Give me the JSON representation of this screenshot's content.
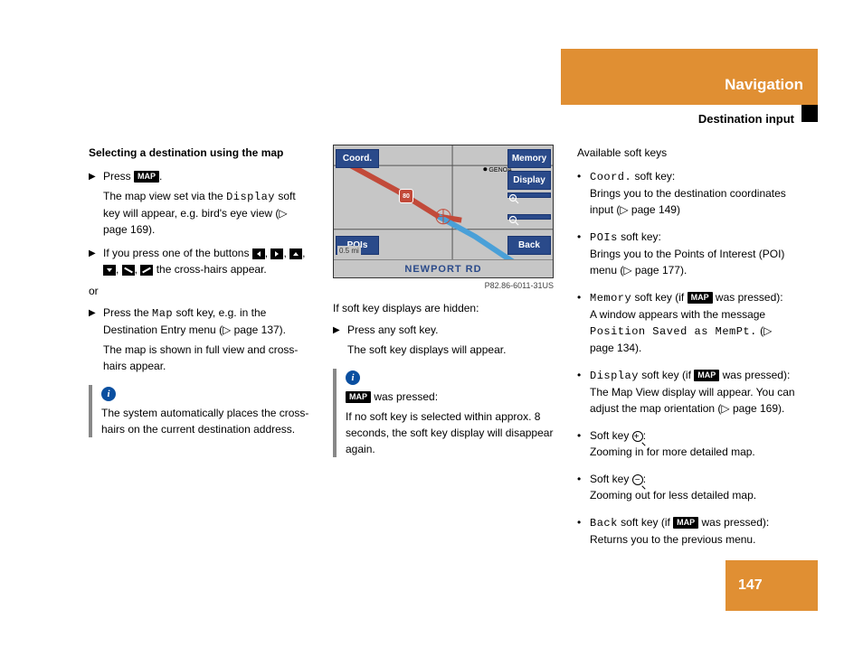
{
  "header": {
    "title": "Navigation",
    "subtitle": "Destination input"
  },
  "footer": {
    "page": "147"
  },
  "col1": {
    "heading": "Selecting a destination using the map",
    "step1_a": "Press ",
    "step1_b": ".",
    "step1_cont_a": "The map view set via the ",
    "step1_cont_b": "Display",
    "step1_cont_c": " soft key will appear, e.g. bird's eye view (▷ page 169).",
    "step2_a": "If you press one of the buttons ",
    "step2_b": " the cross-hairs appear.",
    "or": "or",
    "step3_a": "Press the ",
    "step3_b": "Map",
    "step3_c": " soft key, e.g. in the Destination Entry menu (▷ page 137).",
    "step3_cont": "The map is shown in full view and cross-hairs appear.",
    "info": "The system automatically places the cross-hairs on the current destination address."
  },
  "map": {
    "btn_coord": "Coord.",
    "btn_pois": "POIs",
    "btn_memory": "Memory",
    "btn_display": "Display",
    "btn_back": "Back",
    "road": "NEWPORT RD",
    "hwy": "80",
    "scale": "0.5 mi",
    "caption": "P82.86-6011-31US"
  },
  "col2": {
    "line1": "If soft key displays are hidden:",
    "step1": "Press any soft key.",
    "step1_cont": "The soft key displays will appear.",
    "info_a": " was pressed:",
    "info_b": "If no soft key is selected within approx. 8 seconds, the soft key display will disappear again."
  },
  "col3": {
    "heading": "Available soft keys",
    "b1_a": "Coord.",
    "b1_b": " soft key:",
    "b1_c": "Brings you to the destination coordinates input (▷ page 149)",
    "b2_a": "POIs",
    "b2_b": " soft key:",
    "b2_c": "Brings you to the Points of Interest (POI) menu (▷ page 177).",
    "b3_a": "Memory",
    "b3_b": " soft key (if ",
    "b3_c": " was pressed):",
    "b3_d": "A window appears with the message ",
    "b3_e": "Position Saved as MemPt.",
    "b3_f": " (▷ page 134).",
    "b4_a": "Display",
    "b4_b": " soft key (if ",
    "b4_c": " was pressed):",
    "b4_d": "The Map View display will appear. You can adjust the map orientation (▷ page 169).",
    "b5_a": "Soft key ",
    "b5_b": ":",
    "b5_c": "Zooming in for more detailed map.",
    "b6_a": "Soft key ",
    "b6_b": ":",
    "b6_c": "Zooming out for less detailed map.",
    "b7_a": "Back",
    "b7_b": " soft key (if ",
    "b7_c": " was pressed):",
    "b7_d": "Returns you to the previous menu."
  },
  "labels": {
    "map_pill": "MAP"
  }
}
